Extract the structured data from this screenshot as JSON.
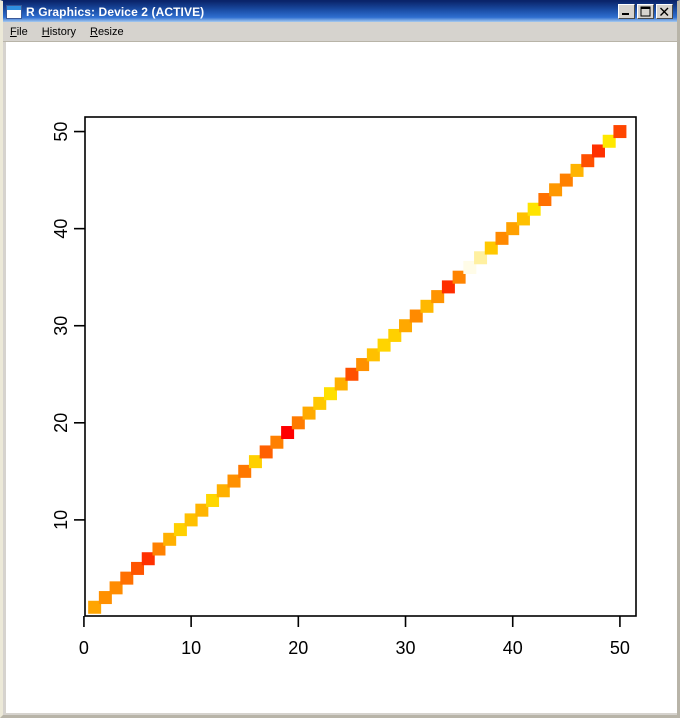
{
  "window": {
    "title": "R Graphics: Device 2 (ACTIVE)",
    "icon": "window-icon",
    "buttons": [
      {
        "name": "minimize-button",
        "label": "_"
      },
      {
        "name": "maximize-button",
        "label": "□"
      },
      {
        "name": "close-button",
        "label": "X"
      }
    ]
  },
  "menu": {
    "items": [
      {
        "name": "menu-file",
        "mnemonic": "F",
        "rest": "ile"
      },
      {
        "name": "menu-history",
        "mnemonic": "H",
        "rest": "istory"
      },
      {
        "name": "menu-resize",
        "mnemonic": "R",
        "rest": "esize"
      }
    ]
  },
  "colors": {
    "titlebar_start": "#0a246a",
    "titlebar_end": "#a6caf0",
    "chrome": "#d6d3ce",
    "canvas_bg": "#ffffff",
    "axis": "#000000"
  },
  "chart_data": {
    "type": "scatter",
    "title": "",
    "xlabel": "",
    "ylabel": "",
    "xlim": [
      0.1,
      51.5
    ],
    "ylim": [
      0.1,
      51.5
    ],
    "grid": false,
    "legend": "none",
    "marker": "filled-square",
    "marker_size": 13,
    "xticks": [
      0,
      10,
      20,
      30,
      40,
      50
    ],
    "yticks": [
      10,
      20,
      30,
      40,
      50
    ],
    "x": [
      1,
      2,
      3,
      4,
      5,
      6,
      7,
      8,
      9,
      10,
      11,
      12,
      13,
      14,
      15,
      16,
      17,
      18,
      19,
      20,
      21,
      22,
      23,
      24,
      25,
      26,
      27,
      28,
      29,
      30,
      31,
      32,
      33,
      34,
      35,
      36,
      37,
      38,
      39,
      40,
      41,
      42,
      43,
      44,
      45,
      46,
      47,
      48,
      49,
      50
    ],
    "y": [
      1,
      2,
      3,
      4,
      5,
      6,
      7,
      8,
      9,
      10,
      11,
      12,
      13,
      14,
      15,
      16,
      17,
      18,
      19,
      20,
      21,
      22,
      23,
      24,
      25,
      26,
      27,
      28,
      29,
      30,
      31,
      32,
      33,
      34,
      35,
      36,
      37,
      38,
      39,
      40,
      41,
      42,
      43,
      44,
      45,
      46,
      47,
      48,
      49,
      50
    ],
    "point_colors": [
      "#FFA500",
      "#FF9000",
      "#FF8C00",
      "#FF7000",
      "#FF5500",
      "#FF3000",
      "#FF8000",
      "#FFB000",
      "#FFD000",
      "#FFC000",
      "#FFB400",
      "#FFD700",
      "#FFB000",
      "#FF9000",
      "#FF7800",
      "#FFD000",
      "#FF6000",
      "#FF8000",
      "#FF0000",
      "#FF7A00",
      "#FFAA00",
      "#FFC800",
      "#FFE000",
      "#FFB000",
      "#FF5000",
      "#FF9000",
      "#FFC000",
      "#FFD400",
      "#FFD000",
      "#FFA800",
      "#FF8A00",
      "#FFB800",
      "#FF9400",
      "#FF2D00",
      "#FF8400",
      "#FFFCE8",
      "#FFF0A0",
      "#FFC800",
      "#FF8800",
      "#FFA000",
      "#FFC000",
      "#FFE400",
      "#FF7000",
      "#FF9800",
      "#FF8000",
      "#FFB400",
      "#FF5000",
      "#FF3000",
      "#FFE800",
      "#FF4500"
    ]
  }
}
